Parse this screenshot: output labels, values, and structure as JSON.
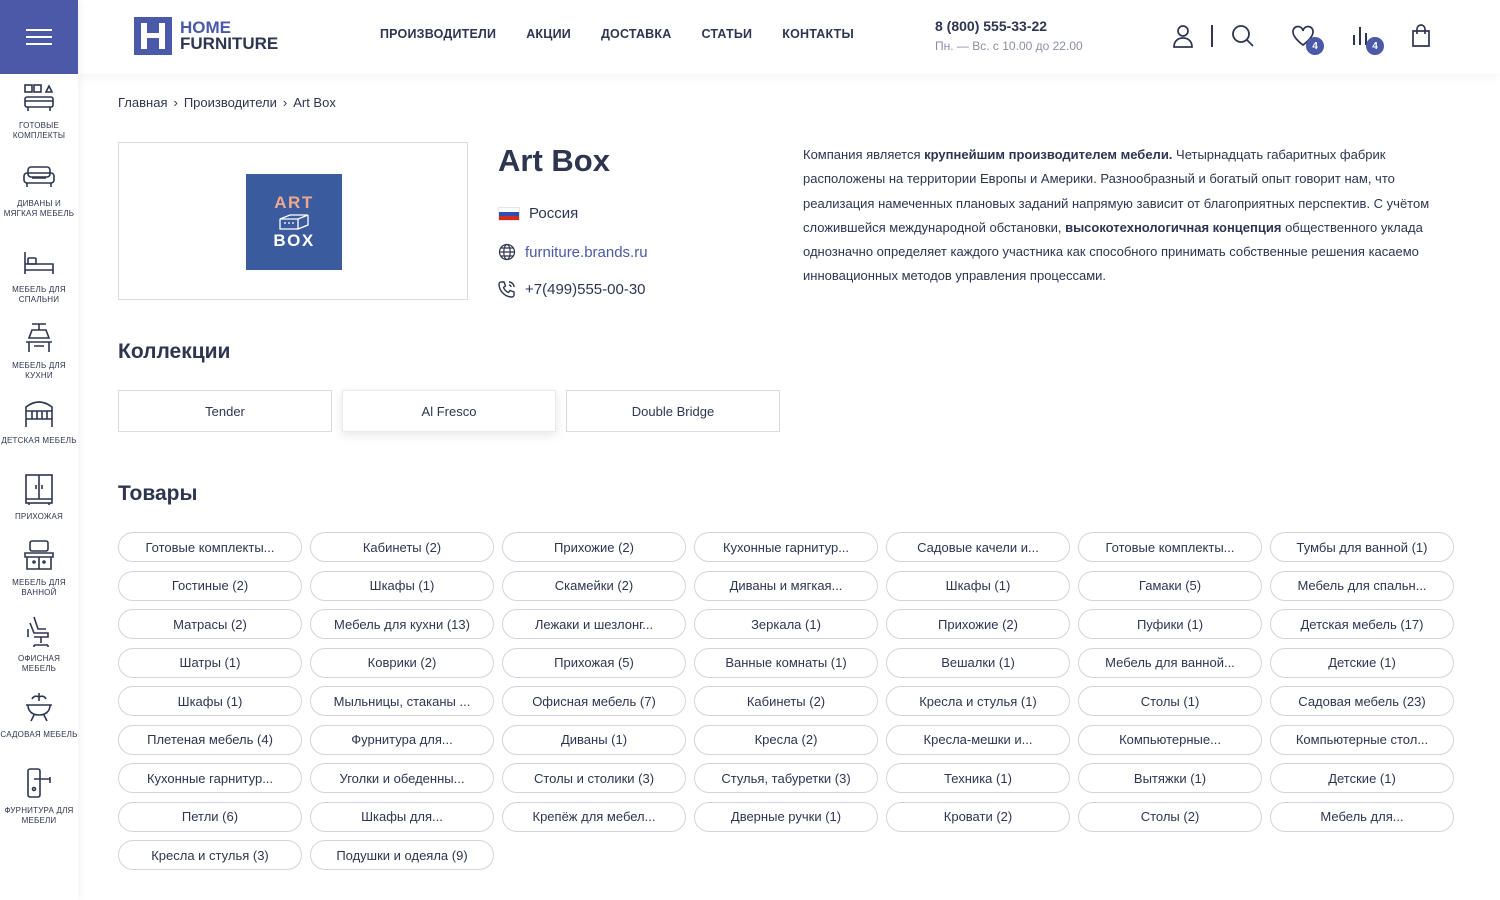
{
  "header": {
    "logo_line1": "HOME",
    "logo_line2": "FURNITURE",
    "logo_letter": "H",
    "nav": [
      "ПРОИЗВОДИТЕЛИ",
      "АКЦИИ",
      "ДОСТАВКА",
      "СТАТЬИ",
      "КОНТАКТЫ"
    ],
    "phone": "8 (800) 555-33-22",
    "hours": "Пн. — Вс. с 10.00 до 22.00",
    "favorites_count": "4",
    "compare_count": "4"
  },
  "sidebar": {
    "items": [
      {
        "label": "ГОТОВЫЕ КОМПЛЕКТЫ",
        "icon": "furniture-set-icon"
      },
      {
        "label": "ДИВАНЫ И МЯГКАЯ МЕБЕЛЬ",
        "icon": "sofa-icon"
      },
      {
        "label": "МЕБЕЛЬ ДЛЯ СПАЛЬНИ",
        "icon": "bed-icon"
      },
      {
        "label": "МЕБЕЛЬ ДЛЯ КУХНИ",
        "icon": "kitchen-icon"
      },
      {
        "label": "ДЕТСКАЯ МЕБЕЛЬ",
        "icon": "crib-icon"
      },
      {
        "label": "ПРИХОЖАЯ",
        "icon": "wardrobe-icon"
      },
      {
        "label": "МЕБЕЛЬ ДЛЯ ВАННОЙ",
        "icon": "washbasin-icon"
      },
      {
        "label": "ОФИСНАЯ МЕБЕЛЬ",
        "icon": "office-chair-icon"
      },
      {
        "label": "САДОВАЯ МЕБЕЛЬ",
        "icon": "garden-icon"
      },
      {
        "label": "ФУРНИТУРА ДЛЯ МЕБЕЛИ",
        "icon": "handle-icon"
      }
    ]
  },
  "breadcrumb": [
    "Главная",
    "Производители",
    "Art Box"
  ],
  "brand": {
    "name": "Art Box",
    "logo_top": "ART",
    "logo_bottom": "BOX",
    "country": "Россия",
    "website": "furniture.brands.ru",
    "phone": "+7(499)555-00-30",
    "desc_1": "Компания является ",
    "desc_b1": "крупнейшим производителем мебели.",
    "desc_2": " Четырнадцать габаритных фабрик расположены на территории Европы и Америки. Разнообразный и богатый опыт говорит нам, что реализация намеченных плановых заданий напрямую зависит от благоприятных перспектив. С учётом сложившейся международной обстановки, ",
    "desc_b2": "высокотехнологичная концепция",
    "desc_3": " общественного уклада однозначно определяет каждого участника как способного принимать собственные решения касаемо инновационных методов управления процессами."
  },
  "collections": {
    "title": "Коллекции",
    "items": [
      "Tender",
      "Al Fresco",
      "Double Bridge"
    ]
  },
  "products": {
    "title": "Товары",
    "tags": [
      "Готовые комплекты...",
      "Кабинеты (2)",
      "Прихожие (2)",
      "Кухонные гарнитур...",
      "Садовые качели и...",
      "Готовые комплекты...",
      "Тумбы для ванной (1)",
      "Гостиные (2)",
      "Шкафы (1)",
      "Скамейки (2)",
      "Диваны и мягкая...",
      "Шкафы (1)",
      "Гамаки (5)",
      "Мебель для спальн...",
      "Матрасы (2)",
      "Мебель для кухни (13)",
      "Лежаки и шезлонг...",
      "Зеркала (1)",
      "Прихожие (2)",
      "Пуфики (1)",
      "Детская мебель (17)",
      "Шатры (1)",
      "Коврики (2)",
      "Прихожая (5)",
      "Ванные комнаты (1)",
      "Вешалки (1)",
      "Мебель для ванной...",
      "Детские (1)",
      "Шкафы (1)",
      "Мыльницы, стаканы ...",
      "Офисная мебель (7)",
      "Кабинеты (2)",
      "Кресла и стулья (1)",
      "Столы (1)",
      "Садовая мебель (23)",
      "Плетеная мебель (4)",
      "Фурнитура для...",
      "Диваны (1)",
      "Кресла (2)",
      "Кресла-мешки и...",
      "Компьютерные...",
      "Компьютерные стол...",
      "Кухонные гарнитур...",
      "Уголки и обеденны...",
      "Столы и столики (3)",
      "Стулья, табуретки (3)",
      "Техника (1)",
      "Вытяжки (1)",
      "Детские (1)",
      "Петли (6)",
      "Шкафы для...",
      "Крепёж для мебел...",
      "Дверные ручки (1)",
      "Кровати (2)",
      "Столы (2)",
      "Мебель для...",
      "Кресла и стулья (3)",
      "Подушки и одеяла (9)"
    ]
  },
  "colors": {
    "brand": "#4a5aa8",
    "text": "#2e3550",
    "artbox_bg": "#3b5b9f",
    "artbox_accent": "#f0a88c"
  }
}
